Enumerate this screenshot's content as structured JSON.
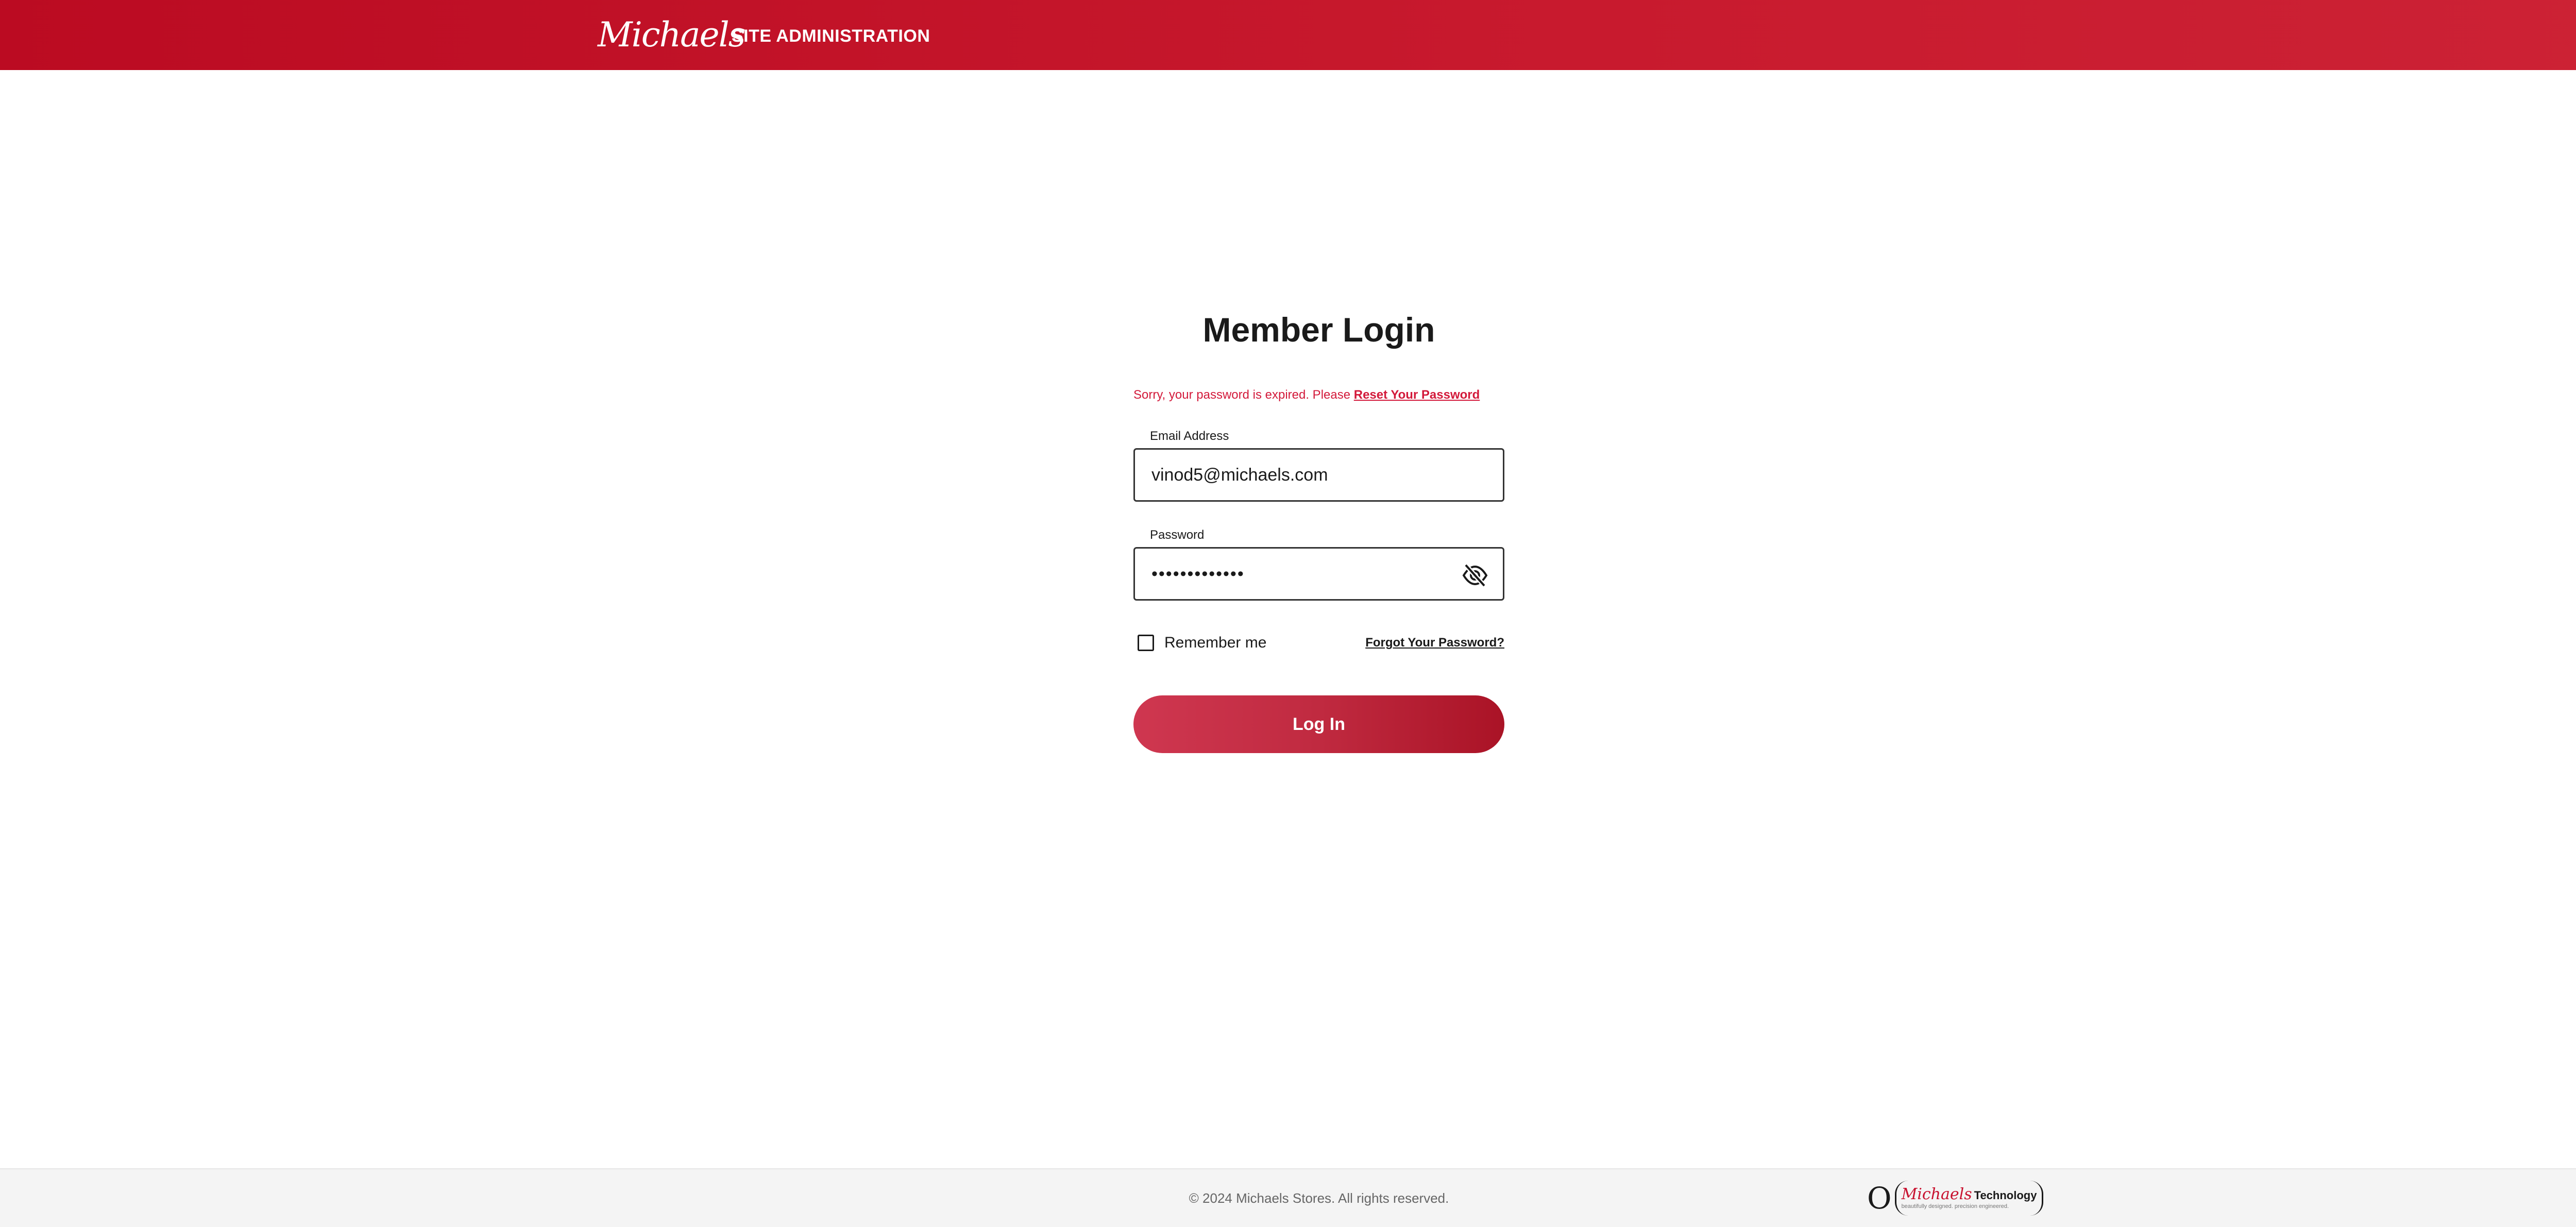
{
  "header": {
    "logo_text": "Michaels",
    "section_title": "SITE ADMINISTRATION",
    "colors": {
      "brand": "#bb0b22"
    }
  },
  "login": {
    "title": "Member Login",
    "error_text": "Sorry, your password is expired. Please ",
    "error_link": "Reset Your Password",
    "email_label": "Email Address",
    "email_value": "vinod5@michaels.com",
    "password_label": "Password",
    "password_masked": "•••••••••••••",
    "password_toggle_icon": "eye-off-icon",
    "remember_label": "Remember me",
    "remember_checked": false,
    "forgot_link": "Forgot Your Password?",
    "login_button": "Log In",
    "colors": {
      "error": "#d3193a",
      "button": "#c02a40"
    }
  },
  "footer": {
    "copyright": "© 2024 Michaels Stores. All rights reserved.",
    "tech_logo": {
      "brand": "Michaels",
      "word": "Technology",
      "tagline": "beautifully designed. precision engineered."
    }
  }
}
